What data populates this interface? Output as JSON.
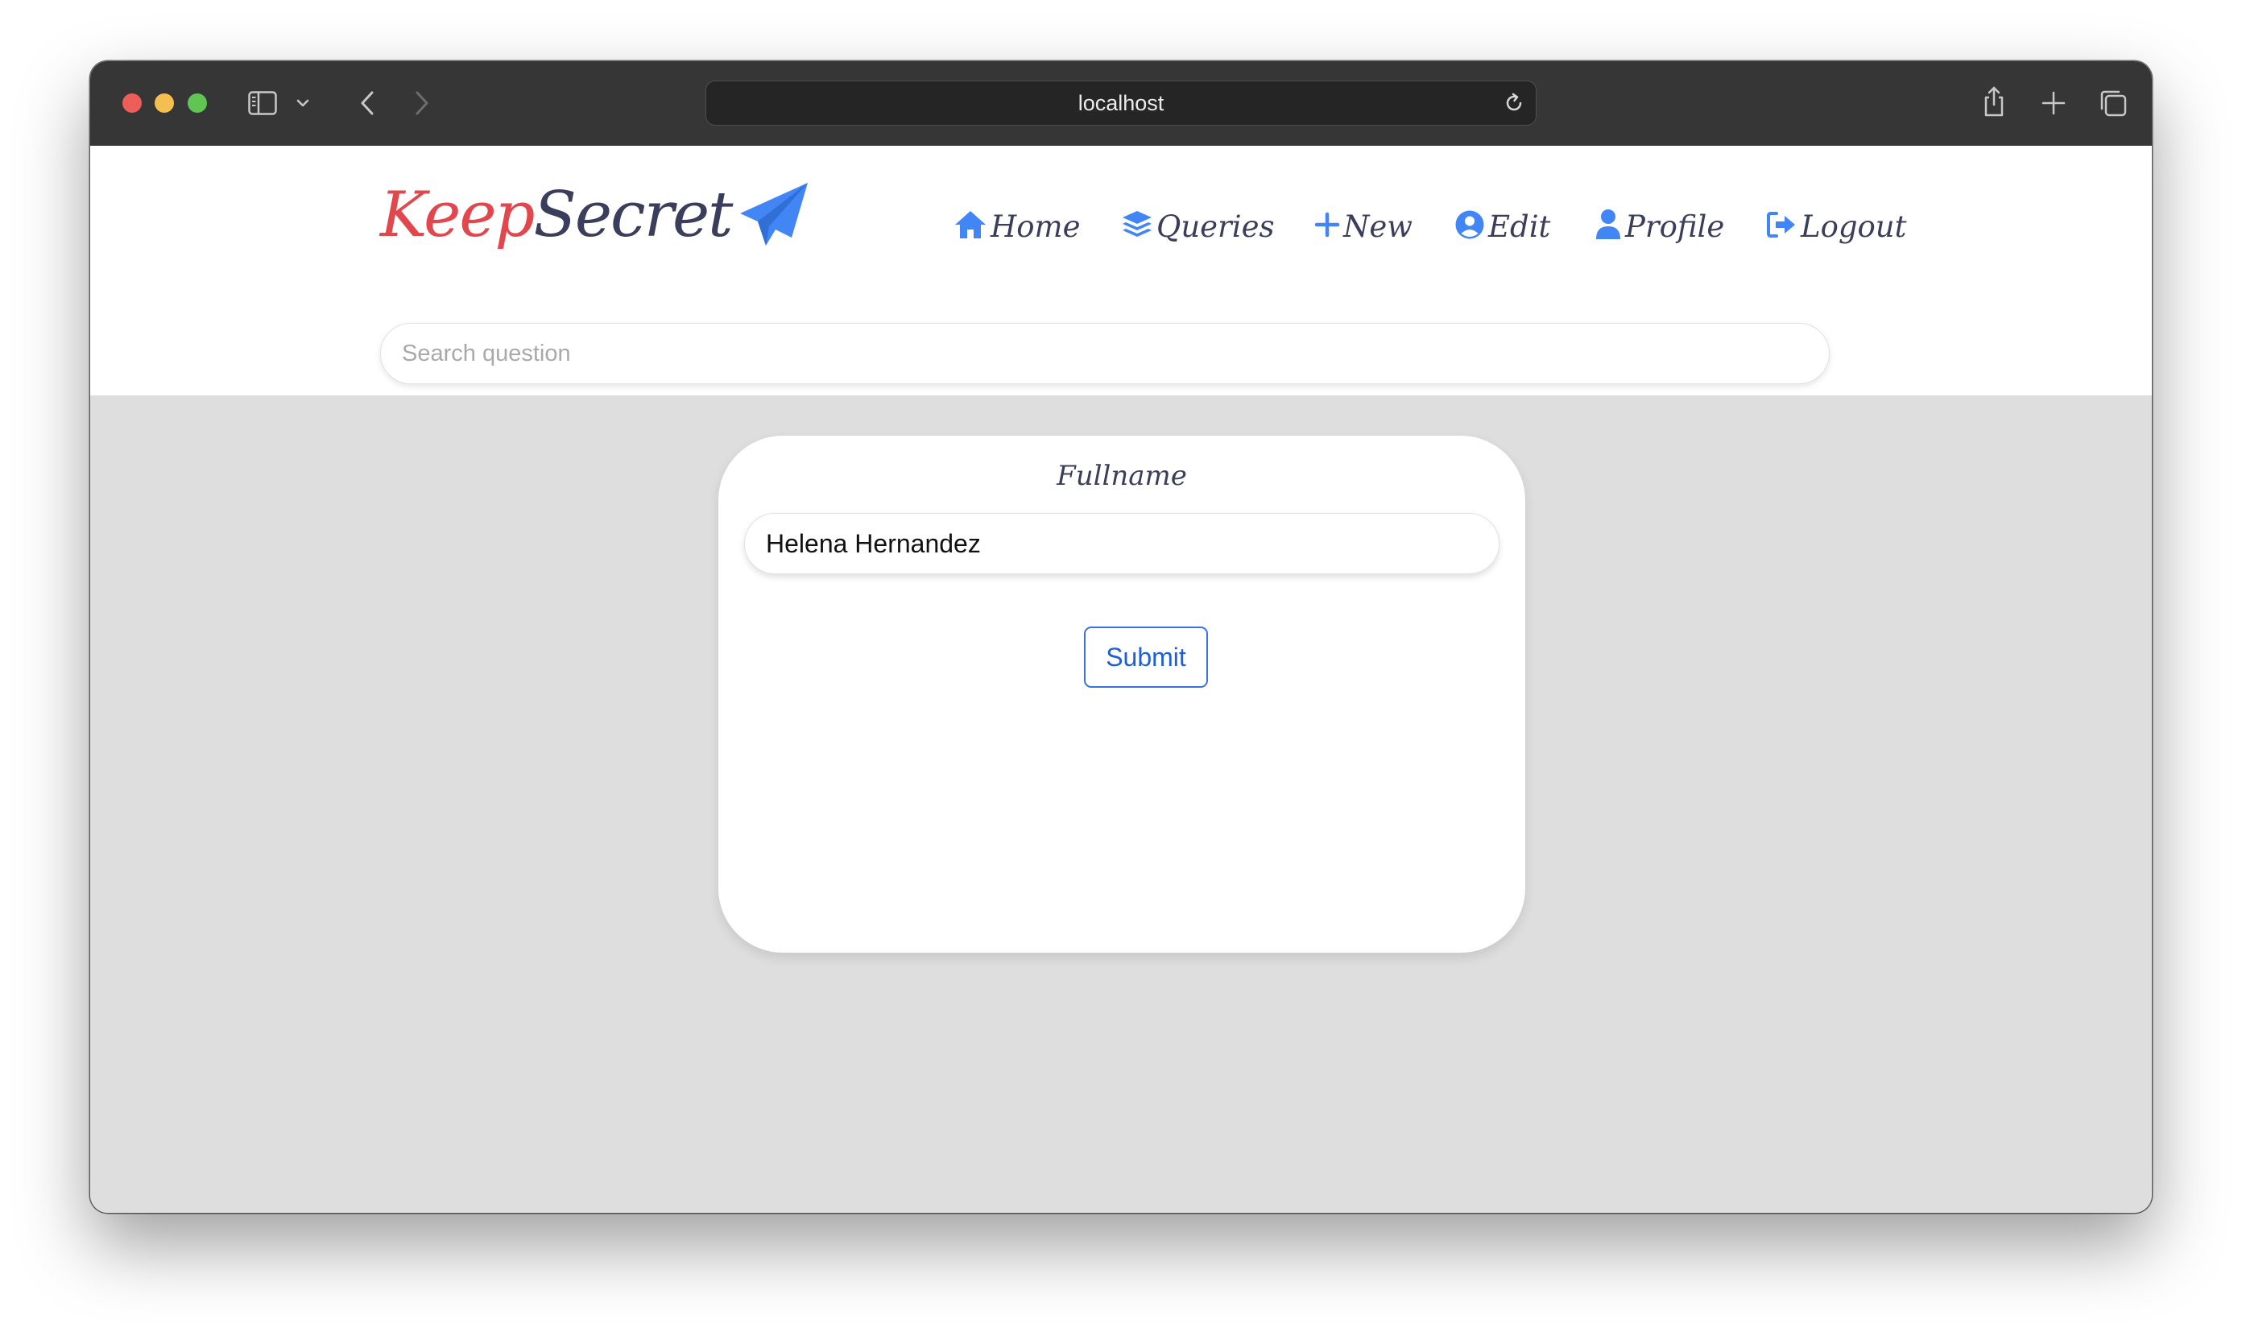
{
  "browser": {
    "address": "localhost"
  },
  "brand": {
    "logo_part1": "Keep",
    "logo_part2": "Secret",
    "accent_color": "#e1474d",
    "dark_color": "#3b3d5c",
    "icon_color": "#4285f4"
  },
  "nav": {
    "items": [
      {
        "label": "Home",
        "icon": "home-icon"
      },
      {
        "label": "Queries",
        "icon": "layers-icon"
      },
      {
        "label": "New",
        "icon": "plus-icon"
      },
      {
        "label": "Edit",
        "icon": "user-circle-icon"
      },
      {
        "label": "Profile",
        "icon": "user-icon"
      },
      {
        "label": "Logout",
        "icon": "sign-out-icon"
      }
    ]
  },
  "search": {
    "placeholder": "Search question",
    "value": ""
  },
  "form": {
    "field_label": "Fullname",
    "field_value": "Helena Hernandez",
    "submit_label": "Submit"
  }
}
